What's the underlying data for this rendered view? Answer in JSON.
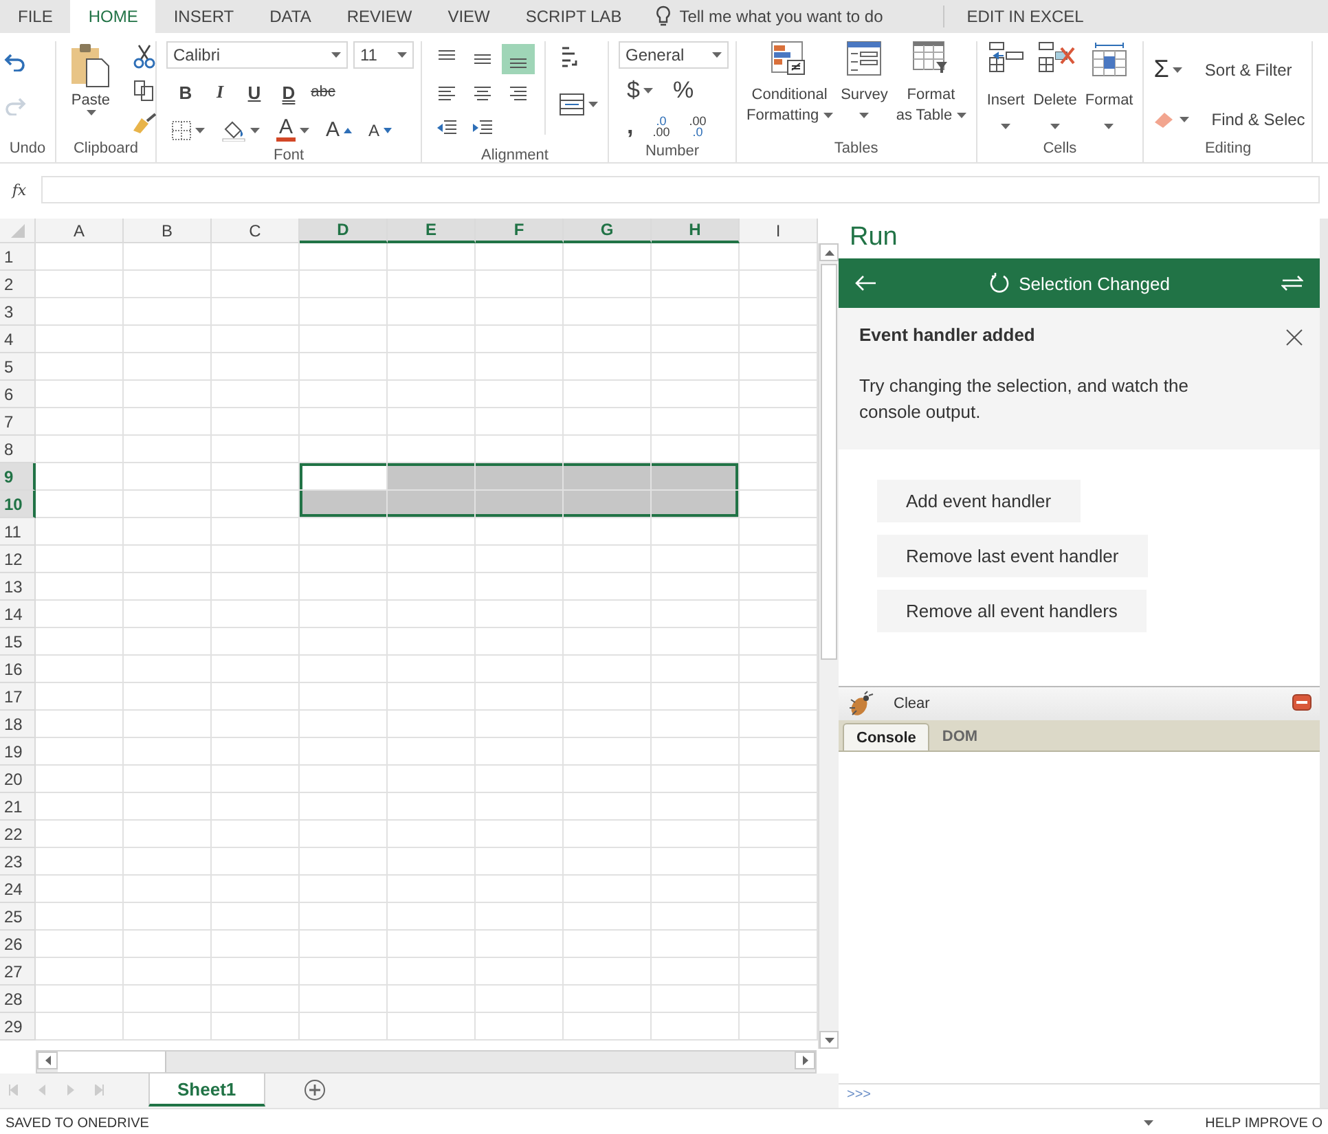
{
  "tabs": [
    {
      "label": "FILE",
      "selected": false
    },
    {
      "label": "HOME",
      "selected": true
    },
    {
      "label": "INSERT",
      "selected": false
    },
    {
      "label": "DATA",
      "selected": false
    },
    {
      "label": "REVIEW",
      "selected": false
    },
    {
      "label": "VIEW",
      "selected": false
    },
    {
      "label": "SCRIPT LAB",
      "selected": false
    }
  ],
  "tell_me": {
    "placeholder": "Tell me what you want to do"
  },
  "edit_in_excel": "EDIT IN EXCEL",
  "ribbon": {
    "undo": {
      "label": "Undo",
      "redo_disabled": true
    },
    "clipboard": {
      "label": "Clipboard",
      "paste": "Paste"
    },
    "font": {
      "label": "Font",
      "name": "Calibri",
      "size": "11",
      "styles": [
        "B",
        "I",
        "U",
        "D",
        "abc"
      ],
      "color_letter": "A",
      "grow": "A",
      "shrink": "A"
    },
    "alignment": {
      "label": "Alignment",
      "vertical": [
        {
          "selected": false
        },
        {
          "selected": false
        },
        {
          "selected": true
        }
      ]
    },
    "number": {
      "label": "Number",
      "format": "General",
      "currency": "$",
      "percent": "%",
      "comma": ",",
      "decimals": [
        ".0",
        ".00",
        ".00",
        ".0"
      ]
    },
    "tables": {
      "label": "Tables",
      "buttons": [
        {
          "line1": "Conditional",
          "line2": "Formatting"
        },
        {
          "line1": "Survey"
        },
        {
          "line1": "Format",
          "line2": "as Table"
        }
      ]
    },
    "cells": {
      "label": "Cells",
      "buttons": [
        "Insert",
        "Delete",
        "Format"
      ]
    },
    "editing": {
      "label": "Editing",
      "sum": "Σ",
      "sort": "Sort & Filter",
      "find": "Find & Selec"
    }
  },
  "formula_bar": {
    "label": "fx"
  },
  "grid": {
    "columns": [
      {
        "label": "A",
        "selected": false
      },
      {
        "label": "B",
        "selected": false
      },
      {
        "label": "C",
        "selected": false
      },
      {
        "label": "D",
        "selected": true
      },
      {
        "label": "E",
        "selected": true
      },
      {
        "label": "F",
        "selected": true
      },
      {
        "label": "G",
        "selected": true
      },
      {
        "label": "H",
        "selected": true
      },
      {
        "label": "I",
        "selected": false
      }
    ],
    "rows": [
      {
        "label": "1",
        "selected": false
      },
      {
        "label": "2",
        "selected": false
      },
      {
        "label": "3",
        "selected": false
      },
      {
        "label": "4",
        "selected": false
      },
      {
        "label": "5",
        "selected": false
      },
      {
        "label": "6",
        "selected": false
      },
      {
        "label": "7",
        "selected": false
      },
      {
        "label": "8",
        "selected": false
      },
      {
        "label": "9",
        "selected": true
      },
      {
        "label": "10",
        "selected": true
      },
      {
        "label": "11",
        "selected": false
      },
      {
        "label": "12",
        "selected": false
      },
      {
        "label": "13",
        "selected": false
      },
      {
        "label": "14",
        "selected": false
      },
      {
        "label": "15",
        "selected": false
      },
      {
        "label": "16",
        "selected": false
      },
      {
        "label": "17",
        "selected": false
      },
      {
        "label": "18",
        "selected": false
      },
      {
        "label": "19",
        "selected": false
      },
      {
        "label": "20",
        "selected": false
      },
      {
        "label": "21",
        "selected": false
      },
      {
        "label": "22",
        "selected": false
      },
      {
        "label": "23",
        "selected": false
      },
      {
        "label": "24",
        "selected": false
      },
      {
        "label": "25",
        "selected": false
      },
      {
        "label": "26",
        "selected": false
      },
      {
        "label": "27",
        "selected": false
      },
      {
        "label": "28",
        "selected": false
      },
      {
        "label": "29",
        "selected": false
      }
    ]
  },
  "sheet_tabs": [
    {
      "label": "Sheet1",
      "selected": true
    }
  ],
  "task_pane": {
    "title": "Run",
    "header": {
      "title": "Selection Changed"
    },
    "notification": {
      "title": "Event handler added",
      "message": "Try changing the selection, and watch the console output."
    },
    "buttons": [
      "Add event handler",
      "Remove last event handler",
      "Remove all event handlers"
    ],
    "console": {
      "clear": "Clear",
      "tabs": [
        {
          "label": "Console",
          "selected": true
        },
        {
          "label": "DOM",
          "selected": false
        }
      ],
      "prompt": ">>>"
    }
  },
  "status_bar": {
    "left": "SAVED TO ONEDRIVE",
    "right": "HELP IMPROVE O"
  }
}
